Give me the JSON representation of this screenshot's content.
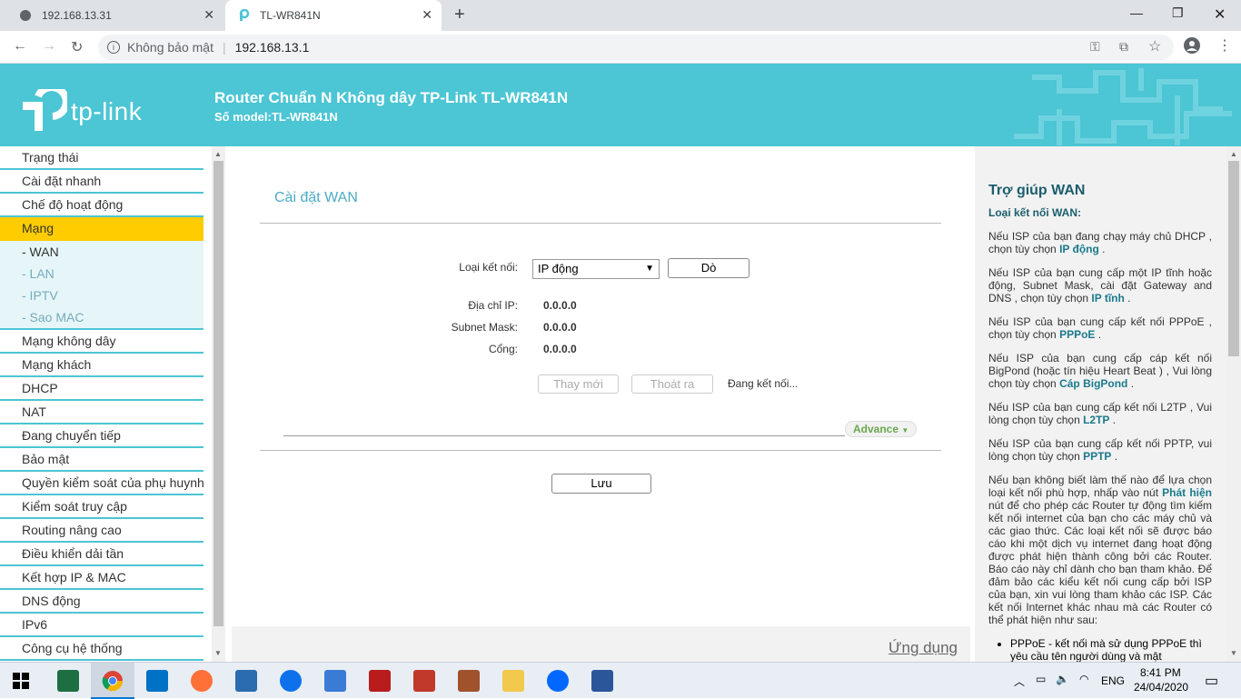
{
  "browser": {
    "tabs": [
      {
        "label": "192.168.13.31"
      },
      {
        "label": "TL-WR841N"
      }
    ],
    "security_label": "Không bảo mật",
    "url": "192.168.13.1"
  },
  "header": {
    "brand": "tp-link",
    "title": "Router Chuẩn N Không dây TP-Link TL-WR841N",
    "model": "Số model:TL-WR841N"
  },
  "menu": {
    "items_top": [
      "Trạng thái",
      "Cài đặt nhanh",
      "Chế độ hoạt động"
    ],
    "active": "Mạng",
    "sub": [
      "- WAN",
      "- LAN",
      "- IPTV",
      "- Sao MAC"
    ],
    "items_bottom": [
      "Mạng không dây",
      "Mạng khách",
      "DHCP",
      "NAT",
      "Đang chuyển tiếp",
      "Bảo mật",
      "Quyền kiểm soát của phụ huynh",
      "Kiểm soát truy cập",
      "Routing nâng cao",
      "Điều khiển dải tần",
      "Kết hợp IP & MAC",
      "DNS động",
      "IPv6",
      "Công cụ hệ thống"
    ]
  },
  "main": {
    "title": "Cài đặt WAN",
    "conn_label": "Loại kết nối:",
    "conn_value": "IP động",
    "detect_btn": "Dò",
    "ip_label": "Địa chỉ IP:",
    "ip_value": "0.0.0.0",
    "mask_label": "Subnet Mask:",
    "mask_value": "0.0.0.0",
    "gw_label": "Cổng:",
    "gw_value": "0.0.0.0",
    "renew_btn": "Thay mới",
    "release_btn": "Thoát ra",
    "status": "Đang kết nối...",
    "advance": "Advance",
    "save_btn": "Lưu",
    "footer_link": "Ứng dụng"
  },
  "help": {
    "title": "Trợ giúp WAN",
    "subtitle": "Loại kết nối WAN:",
    "p1a": "Nếu ISP của bạn đang chạy máy chủ DHCP , chọn tùy chọn ",
    "p1b": "IP động",
    " p1c": " .",
    "p2a": "Nếu ISP của bạn cung cấp một IP tĩnh hoặc động, Subnet Mask, cài đặt Gateway and DNS , chọn tùy chọn ",
    "p2b": "IP tĩnh",
    "p3a": "Nếu ISP của bạn cung cấp kết nối PPPoE , chọn tùy chọn ",
    "p3b": "PPPoE",
    "p4a": "Nếu ISP của bạn cung cấp cáp kết nối BigPond (hoặc tín hiệu Heart Beat ) , Vui lòng chọn tùy chọn ",
    "p4b": "Cáp BigPond",
    "p5a": "Nếu ISP của bạn cung cấp kết nối L2TP , Vui lòng chọn tùy chọn ",
    "p5b": "L2TP",
    "p6a": "Nếu ISP của bạn cung cấp kết nối PPTP, vui lòng chọn tùy chọn ",
    "p6b": "PPTP",
    "p7a": "Nếu bạn không biết làm thế nào để lựa chọn loại kết nối phù hợp, nhấp vào nút ",
    "p7b": "Phát hiện",
    "p7c": " nút để cho phép các Router tự động tìm kiếm kết nối internet của bạn cho các máy chủ và các giao thức. Các loại kết nối sẽ được báo cáo khi một dịch vụ internet đang hoạt động được phát hiện thành công bởi các Router. Báo cáo này chỉ dành cho bạn tham khảo. Để đảm bảo các kiểu kết nối cung cấp bởi ISP của bạn, xin vui lòng tham khảo các ISP. Các kết nối Internet khác nhau mà các Router có thể phát hiện như sau:",
    "li1": "PPPoE - kết nối mà sử dụng PPPoE thì yêu cầu tên người dùng và mật"
  },
  "taskbar": {
    "lang": "ENG",
    "time": "8:41 PM",
    "date": "24/04/2020"
  }
}
